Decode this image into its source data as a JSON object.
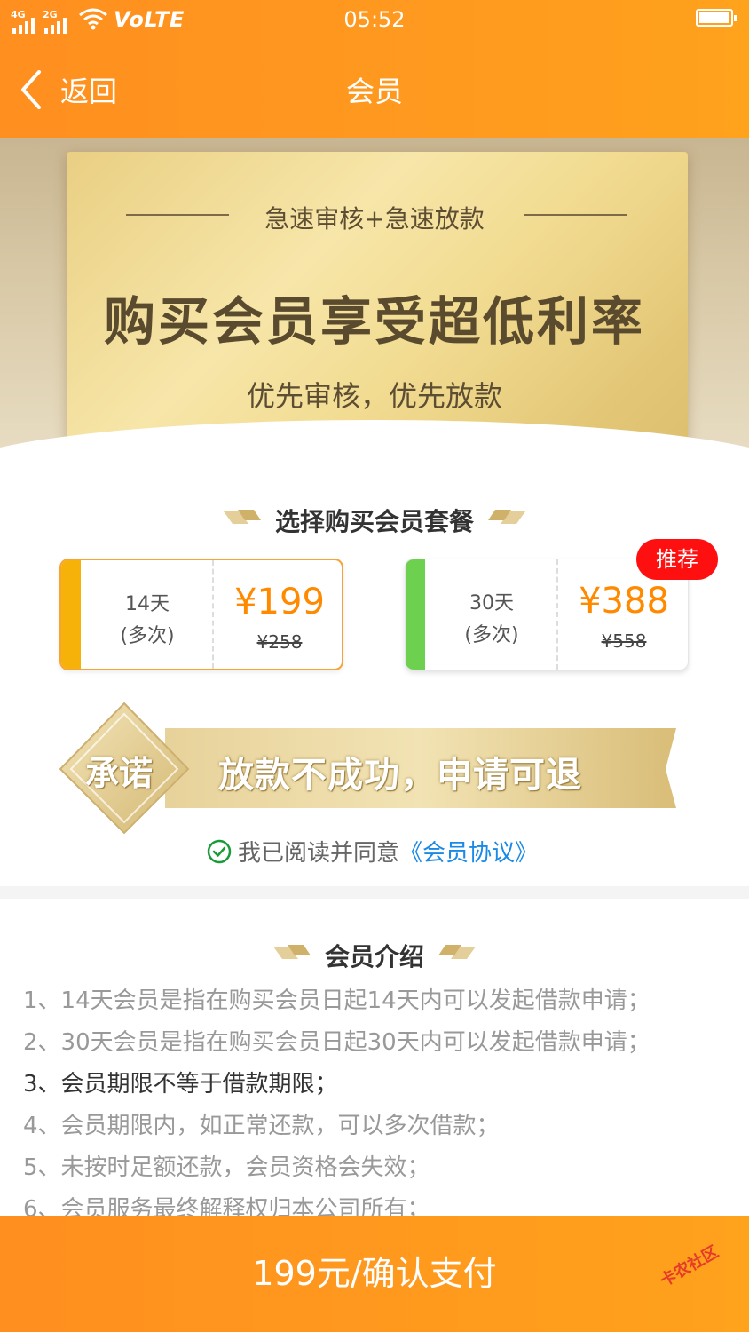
{
  "status_bar": {
    "net1": "4G",
    "net2": "2G",
    "volte": "VoLTE",
    "time": "05:52"
  },
  "header": {
    "back_label": "返回",
    "title": "会员"
  },
  "banner": {
    "subtitle": "急速审核+急速放款",
    "headline": "购买会员享受超低利率",
    "tagline": "优先审核，优先放款"
  },
  "packages": {
    "section_title": "选择购买会员套餐",
    "items": [
      {
        "days": "14天",
        "mode": "(多次)",
        "price": "¥199",
        "original": "¥258",
        "stripe_color": "#f7b20a",
        "selected": true
      },
      {
        "days": "30天",
        "mode": "(多次)",
        "price": "¥388",
        "original": "¥558",
        "stripe_color": "#6dd04f",
        "selected": false
      }
    ],
    "recommend_tag": "推荐"
  },
  "promise": {
    "badge": "承诺",
    "text": "放款不成功，申请可退"
  },
  "agreement": {
    "prefix": "我已阅读并同意",
    "link": "《会员协议》"
  },
  "intro": {
    "title": "会员介绍",
    "items": [
      "1、14天会员是指在购买会员日起14天内可以发起借款申请；",
      "2、30天会员是指在购买会员日起30天内可以发起借款申请；",
      "3、会员期限不等于借款期限；",
      "4、会员期限内，如正常还款，可以多次借款；",
      "5、未按时足额还款，会员资格会失效；",
      "6、会员服务最终解释权归本公司所有；"
    ]
  },
  "pay_button": "199元/确认支付",
  "watermark": "卡农社区",
  "colors": {
    "primary": "#ff9a1f",
    "price": "#ff8a00",
    "link": "#1a8ae6",
    "tag": "#ff1010"
  }
}
